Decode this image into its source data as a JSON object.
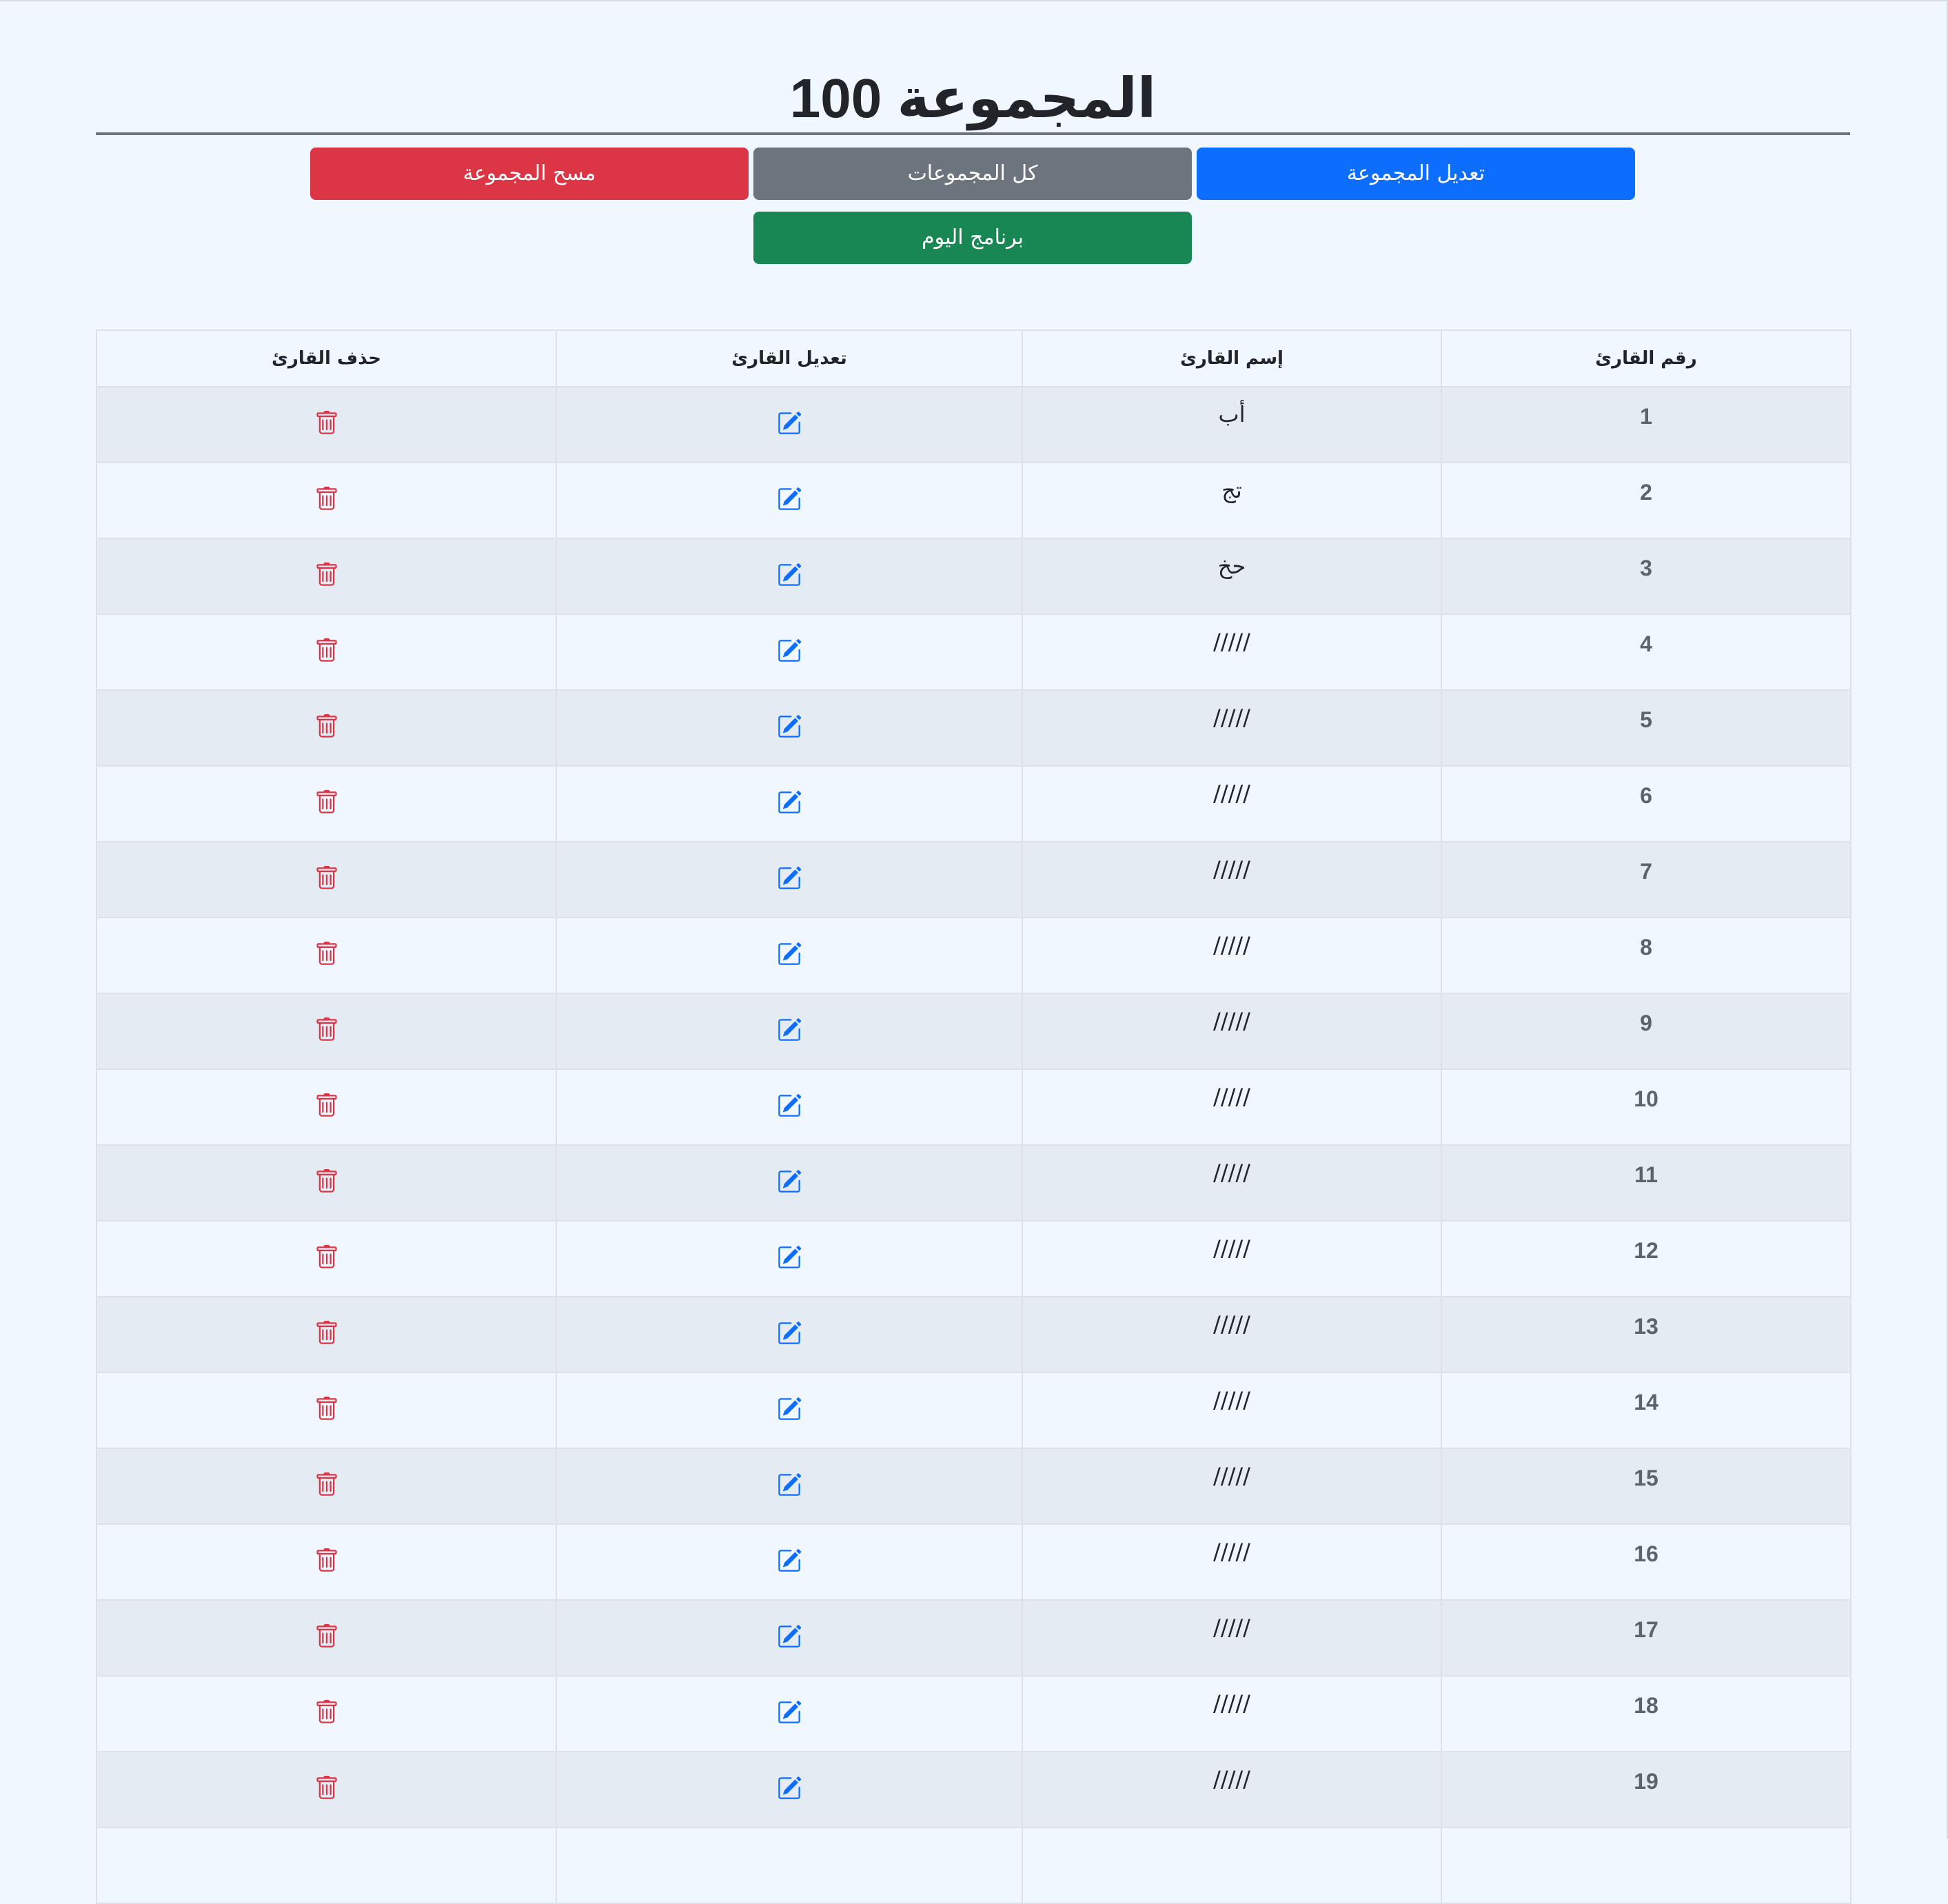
{
  "page": {
    "title": "المجموعة 100"
  },
  "buttons": {
    "edit_group": "تعديل المجموعة",
    "all_groups": "كل المجموعات",
    "delete_group": "مسح المجموعة",
    "today_program": "برنامج اليوم"
  },
  "colors": {
    "primary": "#0d6efd",
    "secondary": "#6c757d",
    "danger": "#dc3545",
    "success": "#198754",
    "page_bg": "#f0f7ff",
    "stripe_bg": "#e5ebf3"
  },
  "table": {
    "headers": {
      "number": "رقم القارئ",
      "name": "إسم القارئ",
      "edit": "تعديل القارئ",
      "delete": "حذف القارئ"
    },
    "edit_icon": "edit-icon",
    "delete_icon": "trash-icon",
    "rows": [
      {
        "number": "1",
        "name": "أب"
      },
      {
        "number": "2",
        "name": "تج"
      },
      {
        "number": "3",
        "name": "حخ"
      },
      {
        "number": "4",
        "name": "/////"
      },
      {
        "number": "5",
        "name": "/////"
      },
      {
        "number": "6",
        "name": "/////"
      },
      {
        "number": "7",
        "name": "/////"
      },
      {
        "number": "8",
        "name": "/////"
      },
      {
        "number": "9",
        "name": "/////"
      },
      {
        "number": "10",
        "name": "/////"
      },
      {
        "number": "11",
        "name": "/////"
      },
      {
        "number": "12",
        "name": "/////"
      },
      {
        "number": "13",
        "name": "/////"
      },
      {
        "number": "14",
        "name": "/////"
      },
      {
        "number": "15",
        "name": "/////"
      },
      {
        "number": "16",
        "name": "/////"
      },
      {
        "number": "17",
        "name": "/////"
      },
      {
        "number": "18",
        "name": "/////"
      },
      {
        "number": "19",
        "name": "/////"
      },
      {
        "number": "",
        "name": ""
      }
    ]
  }
}
